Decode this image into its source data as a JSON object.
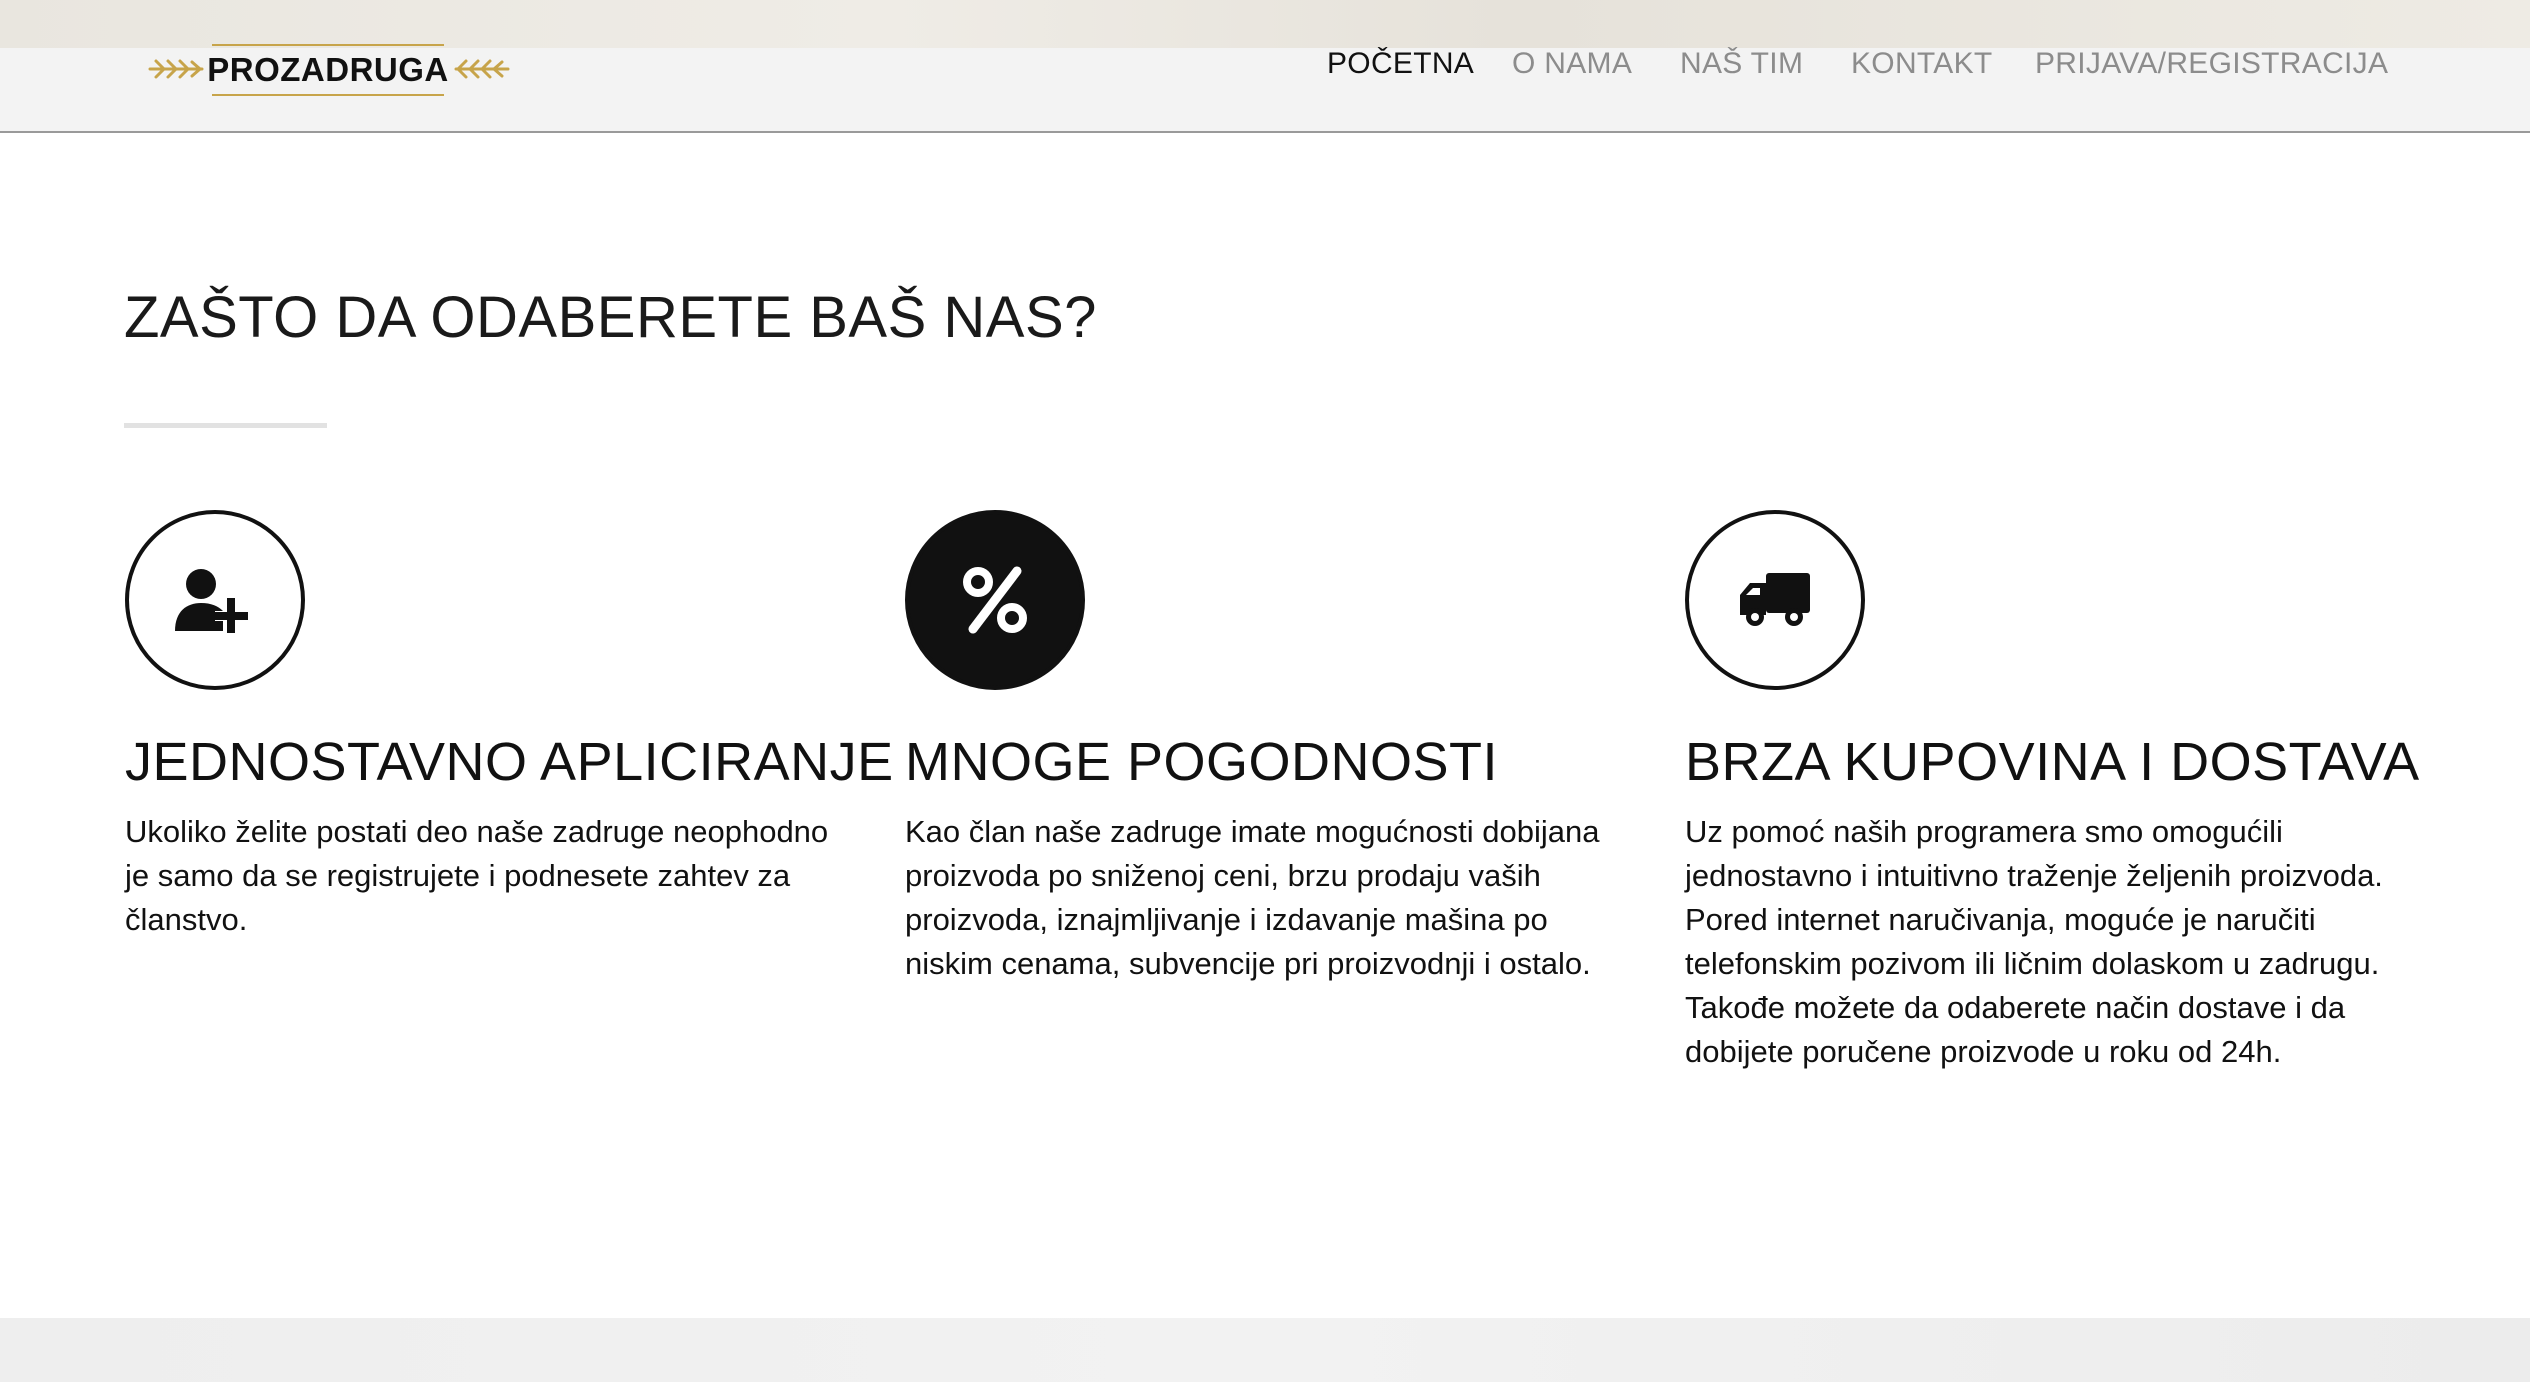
{
  "brand": {
    "logo_text": "PROZADRUGA",
    "accent_color": "#c7a44a"
  },
  "nav": {
    "items": [
      {
        "label": "POČETNA",
        "active": true
      },
      {
        "label": "O NAMA",
        "active": false
      },
      {
        "label": "NAŠ TIM",
        "active": false
      },
      {
        "label": "KONTAKT",
        "active": false
      },
      {
        "label": "PRIJAVA/REGISTRACIJA",
        "active": false
      }
    ]
  },
  "section": {
    "title": "ZAŠTO DA ODABERETE BAŠ NAS?",
    "features": [
      {
        "icon": "user-plus-icon",
        "title": "JEDNOSTAVNO APLICIRANJE",
        "text": "Ukoliko želite postati deo naše zadruge neophodno je samo da se registrujete i podnesete zahtev za članstvo."
      },
      {
        "icon": "percent-icon",
        "title": "MNOGE POGODNOSTI",
        "text": "Kao član naše zadruge imate mogućnosti dobijana proizvoda po sniženoj ceni, brzu prodaju vaših proizvoda, iznajmljivanje i izdavanje mašina po niskim cenama, subvencije pri proizvodnji i ostalo."
      },
      {
        "icon": "truck-icon",
        "title": "BRZA KUPOVINA I DOSTAVA",
        "text": "Uz pomoć naših programera smo omogućili jednostavno i intuitivno traženje željenih proizvoda. Pored internet naručivanja, moguće je naručiti telefonskim pozivom ili ličnim dolaskom u zadrugu. Takođe možete da odaberete način dostave i da dobijete poručene proizvode u roku od 24h."
      }
    ]
  }
}
